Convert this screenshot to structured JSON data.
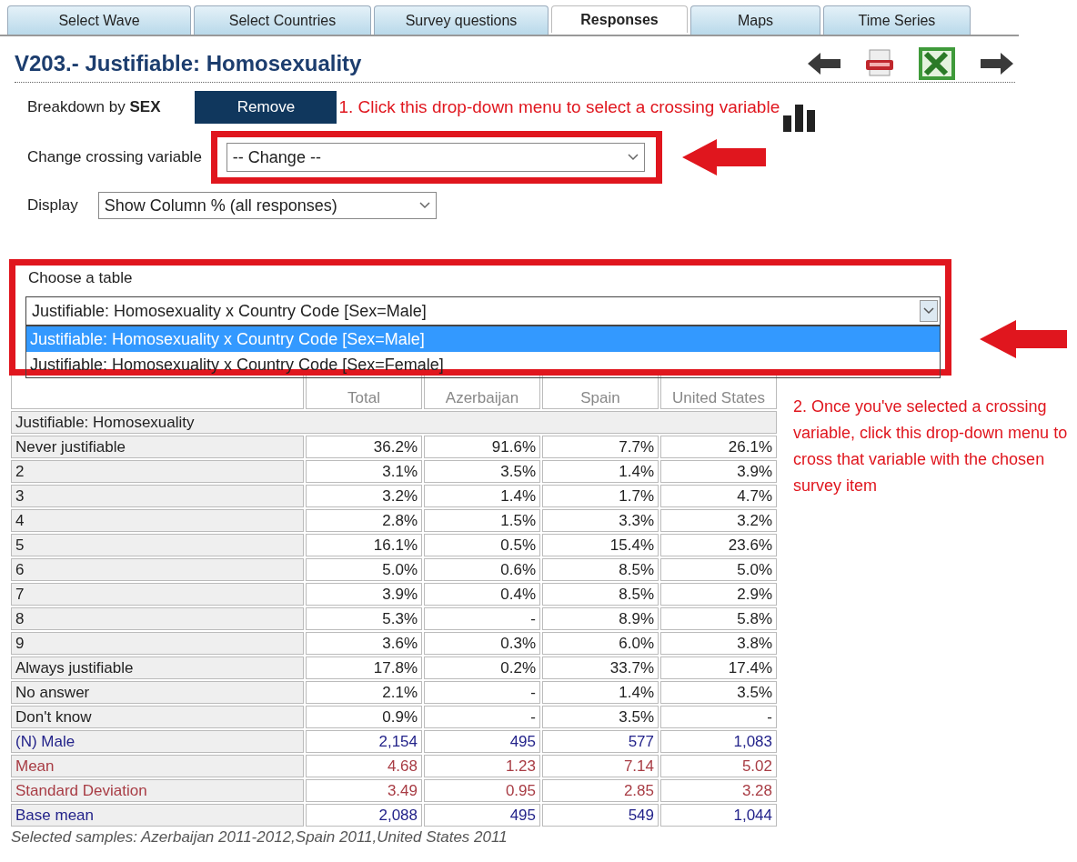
{
  "tabs": [
    {
      "label": "Select Wave",
      "selected": false
    },
    {
      "label": "Select Countries",
      "selected": false
    },
    {
      "label": "Survey questions",
      "selected": false
    },
    {
      "label": "Responses",
      "selected": true
    },
    {
      "label": "Maps",
      "selected": false
    },
    {
      "label": "Time Series",
      "selected": false
    }
  ],
  "title": "V203.- Justifiable: Homosexuality",
  "breakdown": {
    "label": "Breakdown by **SEX**",
    "button": "Remove"
  },
  "annotation_1": "1. Click this drop-down menu to select a crossing variable",
  "crossing": {
    "label": "Change crossing variable",
    "value": "-- Change --"
  },
  "display": {
    "label": "Display",
    "value": "Show Column % (all responses)"
  },
  "table_chooser": {
    "label": "Choose a table",
    "value": "Justifiable: Homosexuality x Country Code [Sex=Male]",
    "options": [
      {
        "label": "Justifiable: Homosexuality x Country Code [Sex=Male]",
        "selected": true
      },
      {
        "label": "Justifiable: Homosexuality x Country Code [Sex=Female]",
        "selected": false
      }
    ]
  },
  "annotation_2": "2. Once you've selected a crossing variable, click this drop-down menu to cross that variable with the chosen survey item",
  "table": {
    "columns": [
      "Total",
      "Azerbaijan",
      "Spain",
      "United States"
    ],
    "section": "Justifiable: Homosexuality",
    "rows": [
      {
        "label": "Never justifiable",
        "kind": "percent",
        "cells": [
          "36.2%",
          "91.6%",
          "7.7%",
          "26.1%"
        ]
      },
      {
        "label": "2",
        "kind": "percent",
        "cells": [
          "3.1%",
          "3.5%",
          "1.4%",
          "3.9%"
        ]
      },
      {
        "label": "3",
        "kind": "percent",
        "cells": [
          "3.2%",
          "1.4%",
          "1.7%",
          "4.7%"
        ]
      },
      {
        "label": "4",
        "kind": "percent",
        "cells": [
          "2.8%",
          "1.5%",
          "3.3%",
          "3.2%"
        ]
      },
      {
        "label": "5",
        "kind": "percent",
        "cells": [
          "16.1%",
          "0.5%",
          "15.4%",
          "23.6%"
        ]
      },
      {
        "label": "6",
        "kind": "percent",
        "cells": [
          "5.0%",
          "0.6%",
          "8.5%",
          "5.0%"
        ]
      },
      {
        "label": "7",
        "kind": "percent",
        "cells": [
          "3.9%",
          "0.4%",
          "8.5%",
          "2.9%"
        ]
      },
      {
        "label": "8",
        "kind": "percent",
        "cells": [
          "5.3%",
          "-",
          "8.9%",
          "5.8%"
        ]
      },
      {
        "label": "9",
        "kind": "percent",
        "cells": [
          "3.6%",
          "0.3%",
          "6.0%",
          "3.8%"
        ]
      },
      {
        "label": "Always justifiable",
        "kind": "percent",
        "cells": [
          "17.8%",
          "0.2%",
          "33.7%",
          "17.4%"
        ]
      },
      {
        "label": "No answer",
        "kind": "percent",
        "cells": [
          "2.1%",
          "-",
          "1.4%",
          "3.5%"
        ]
      },
      {
        "label": "Don't know",
        "kind": "percent",
        "cells": [
          "0.9%",
          "-",
          "3.5%",
          "-"
        ]
      },
      {
        "label": "(N) Male",
        "kind": "count",
        "cells": [
          "2,154",
          "495",
          "577",
          "1,083"
        ]
      },
      {
        "label": "Mean",
        "kind": "stat",
        "cells": [
          "4.68",
          "1.23",
          "7.14",
          "5.02"
        ]
      },
      {
        "label": "Standard Deviation",
        "kind": "stat",
        "cells": [
          "3.49",
          "0.95",
          "2.85",
          "3.28"
        ]
      },
      {
        "label": "Base mean",
        "kind": "count",
        "cells": [
          "2,088",
          "495",
          "549",
          "1,044"
        ]
      }
    ]
  },
  "footnote": "Selected samples: Azerbaijan 2011-2012,Spain 2011,United States 2011"
}
